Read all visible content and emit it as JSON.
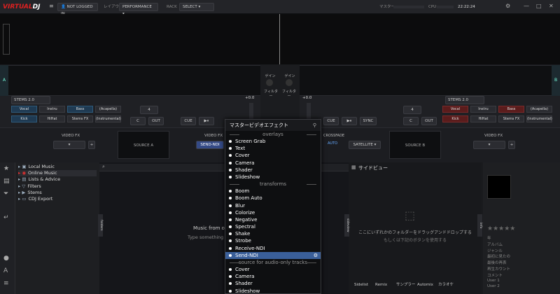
{
  "app": {
    "logo_a": "VIRTUAL",
    "logo_b": "DJ"
  },
  "topbar": {
    "login": "NOT LOGGED IN",
    "layout_label": "レイアウト",
    "layout_value": "PERFORMANCE",
    "rack_label": "RACK",
    "rack_value": "SELECT",
    "master_label": "マスター",
    "cpu_label": "CPU",
    "clock": "22:22:24"
  },
  "decks": {
    "left_marker": "A",
    "right_marker": "B",
    "stems_left": "STEMS 2.0",
    "stems_right": "STEMS 2.0",
    "pads_left": [
      {
        "label": "Vocal",
        "color": "blue"
      },
      {
        "label": "Instru",
        "color": "plain"
      },
      {
        "label": "Bass",
        "color": "blue"
      },
      {
        "label": "(Acapella)",
        "color": "plain"
      },
      {
        "label": "Kick",
        "color": "blue"
      },
      {
        "label": "HiHat",
        "color": "plain"
      },
      {
        "label": "Stems FX",
        "color": "plain"
      },
      {
        "label": "(Instrumental)",
        "color": "plain"
      }
    ],
    "pads_right": [
      {
        "label": "Vocal",
        "color": "red"
      },
      {
        "label": "Instru",
        "color": "plain"
      },
      {
        "label": "Bass",
        "color": "red"
      },
      {
        "label": "(Acapella)",
        "color": "plain"
      },
      {
        "label": "Kick",
        "color": "red"
      },
      {
        "label": "HiHat",
        "color": "plain"
      },
      {
        "label": "Stems FX",
        "color": "plain"
      },
      {
        "label": "(Instrumental)",
        "color": "plain"
      }
    ],
    "loop_left": "4",
    "loop_right": "4",
    "cue": "CUE",
    "sync": "SYNC",
    "in": "C",
    "out": "OUT",
    "gain": "ゲイン",
    "filter": "フィルター",
    "pitch_left": "+0.0",
    "pitch_right": "+0.0"
  },
  "fx": {
    "video_fx": "VIDEO FX",
    "source_a": "SOURCE A",
    "source_b": "SOURCE B",
    "send_ndi": "SEND-NDI",
    "auto": "AUTO",
    "satellite": "SATELLITE",
    "crossfade": "CROSSFADE",
    "video_fx_right": "VIDEO FX"
  },
  "browser": {
    "tree": [
      {
        "label": "Local Music",
        "icon": "folder-icon"
      },
      {
        "label": "Online Music",
        "icon": "globe-icon"
      },
      {
        "label": "Lists & Advice",
        "icon": "list-icon"
      },
      {
        "label": "Filters",
        "icon": "filter-icon"
      },
      {
        "label": "Stems",
        "icon": "stems-icon"
      },
      {
        "label": "CDJ Export",
        "icon": "cdj-icon"
      }
    ],
    "main_title": "Music from on",
    "main_hint": "Type something i",
    "side_title": "サイドビュー",
    "side_hint1": "ここにいずれかのフォルダーをドラッグアンドドロップする",
    "side_hint2": "もしくは下記のボタンを使用する",
    "side_buttons": [
      "Sidelist",
      "Remix",
      "サンプラー",
      "Automix",
      "カラオケ"
    ],
    "info_fields": [
      "年",
      "アルバム",
      "ジャンル",
      "最初に見たの",
      "最後の再表",
      "再生カウント",
      "コメント",
      "User 1",
      "User 2"
    ]
  },
  "popup": {
    "title": "マスタービデオエフェクト",
    "sections": [
      {
        "header": "overlays",
        "items": [
          "Screen Grab",
          "Text",
          "Cover",
          "Camera",
          "Shader",
          "Slideshow"
        ]
      },
      {
        "header": "transforms",
        "items": [
          "Boom",
          "Boom Auto",
          "Blur",
          "Colorize",
          "Negative",
          "Spectral",
          "Shake",
          "Strobe",
          "Receive-NDI",
          "Send-NDI"
        ]
      },
      {
        "header": "source for audio-only tracks",
        "items": [
          "Cover",
          "Camera",
          "Shader",
          "Slideshow"
        ]
      }
    ],
    "selected": "Send-NDI"
  }
}
